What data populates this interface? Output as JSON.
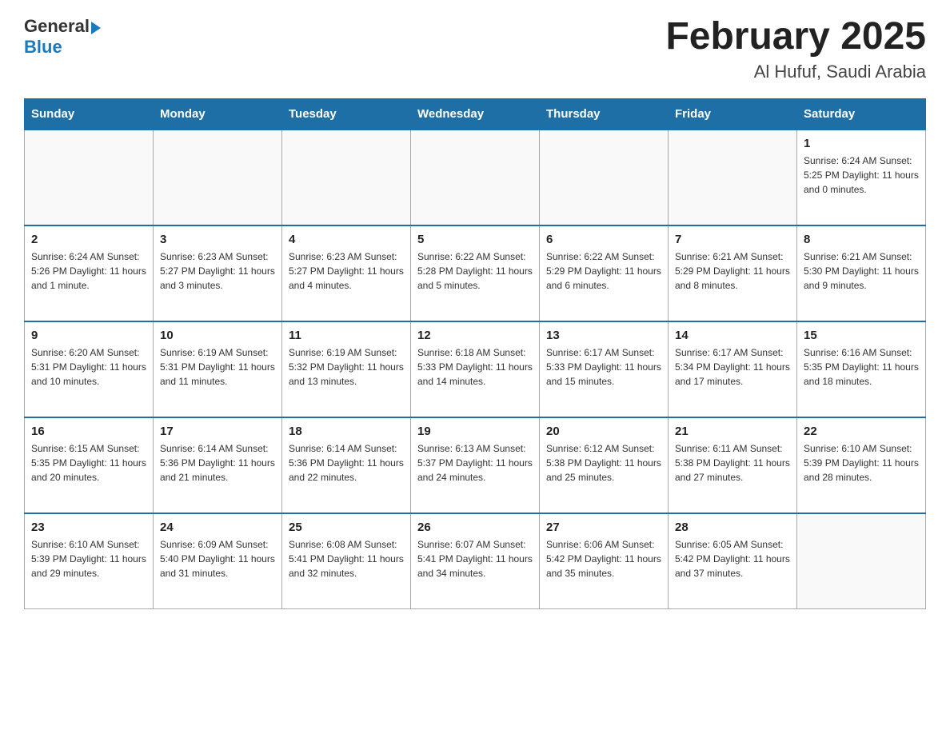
{
  "header": {
    "logo_general": "General",
    "logo_blue": "Blue",
    "month_title": "February 2025",
    "location": "Al Hufuf, Saudi Arabia"
  },
  "weekdays": [
    "Sunday",
    "Monday",
    "Tuesday",
    "Wednesday",
    "Thursday",
    "Friday",
    "Saturday"
  ],
  "weeks": [
    [
      {
        "day": "",
        "info": ""
      },
      {
        "day": "",
        "info": ""
      },
      {
        "day": "",
        "info": ""
      },
      {
        "day": "",
        "info": ""
      },
      {
        "day": "",
        "info": ""
      },
      {
        "day": "",
        "info": ""
      },
      {
        "day": "1",
        "info": "Sunrise: 6:24 AM\nSunset: 5:25 PM\nDaylight: 11 hours and 0 minutes."
      }
    ],
    [
      {
        "day": "2",
        "info": "Sunrise: 6:24 AM\nSunset: 5:26 PM\nDaylight: 11 hours and 1 minute."
      },
      {
        "day": "3",
        "info": "Sunrise: 6:23 AM\nSunset: 5:27 PM\nDaylight: 11 hours and 3 minutes."
      },
      {
        "day": "4",
        "info": "Sunrise: 6:23 AM\nSunset: 5:27 PM\nDaylight: 11 hours and 4 minutes."
      },
      {
        "day": "5",
        "info": "Sunrise: 6:22 AM\nSunset: 5:28 PM\nDaylight: 11 hours and 5 minutes."
      },
      {
        "day": "6",
        "info": "Sunrise: 6:22 AM\nSunset: 5:29 PM\nDaylight: 11 hours and 6 minutes."
      },
      {
        "day": "7",
        "info": "Sunrise: 6:21 AM\nSunset: 5:29 PM\nDaylight: 11 hours and 8 minutes."
      },
      {
        "day": "8",
        "info": "Sunrise: 6:21 AM\nSunset: 5:30 PM\nDaylight: 11 hours and 9 minutes."
      }
    ],
    [
      {
        "day": "9",
        "info": "Sunrise: 6:20 AM\nSunset: 5:31 PM\nDaylight: 11 hours and 10 minutes."
      },
      {
        "day": "10",
        "info": "Sunrise: 6:19 AM\nSunset: 5:31 PM\nDaylight: 11 hours and 11 minutes."
      },
      {
        "day": "11",
        "info": "Sunrise: 6:19 AM\nSunset: 5:32 PM\nDaylight: 11 hours and 13 minutes."
      },
      {
        "day": "12",
        "info": "Sunrise: 6:18 AM\nSunset: 5:33 PM\nDaylight: 11 hours and 14 minutes."
      },
      {
        "day": "13",
        "info": "Sunrise: 6:17 AM\nSunset: 5:33 PM\nDaylight: 11 hours and 15 minutes."
      },
      {
        "day": "14",
        "info": "Sunrise: 6:17 AM\nSunset: 5:34 PM\nDaylight: 11 hours and 17 minutes."
      },
      {
        "day": "15",
        "info": "Sunrise: 6:16 AM\nSunset: 5:35 PM\nDaylight: 11 hours and 18 minutes."
      }
    ],
    [
      {
        "day": "16",
        "info": "Sunrise: 6:15 AM\nSunset: 5:35 PM\nDaylight: 11 hours and 20 minutes."
      },
      {
        "day": "17",
        "info": "Sunrise: 6:14 AM\nSunset: 5:36 PM\nDaylight: 11 hours and 21 minutes."
      },
      {
        "day": "18",
        "info": "Sunrise: 6:14 AM\nSunset: 5:36 PM\nDaylight: 11 hours and 22 minutes."
      },
      {
        "day": "19",
        "info": "Sunrise: 6:13 AM\nSunset: 5:37 PM\nDaylight: 11 hours and 24 minutes."
      },
      {
        "day": "20",
        "info": "Sunrise: 6:12 AM\nSunset: 5:38 PM\nDaylight: 11 hours and 25 minutes."
      },
      {
        "day": "21",
        "info": "Sunrise: 6:11 AM\nSunset: 5:38 PM\nDaylight: 11 hours and 27 minutes."
      },
      {
        "day": "22",
        "info": "Sunrise: 6:10 AM\nSunset: 5:39 PM\nDaylight: 11 hours and 28 minutes."
      }
    ],
    [
      {
        "day": "23",
        "info": "Sunrise: 6:10 AM\nSunset: 5:39 PM\nDaylight: 11 hours and 29 minutes."
      },
      {
        "day": "24",
        "info": "Sunrise: 6:09 AM\nSunset: 5:40 PM\nDaylight: 11 hours and 31 minutes."
      },
      {
        "day": "25",
        "info": "Sunrise: 6:08 AM\nSunset: 5:41 PM\nDaylight: 11 hours and 32 minutes."
      },
      {
        "day": "26",
        "info": "Sunrise: 6:07 AM\nSunset: 5:41 PM\nDaylight: 11 hours and 34 minutes."
      },
      {
        "day": "27",
        "info": "Sunrise: 6:06 AM\nSunset: 5:42 PM\nDaylight: 11 hours and 35 minutes."
      },
      {
        "day": "28",
        "info": "Sunrise: 6:05 AM\nSunset: 5:42 PM\nDaylight: 11 hours and 37 minutes."
      },
      {
        "day": "",
        "info": ""
      }
    ]
  ]
}
